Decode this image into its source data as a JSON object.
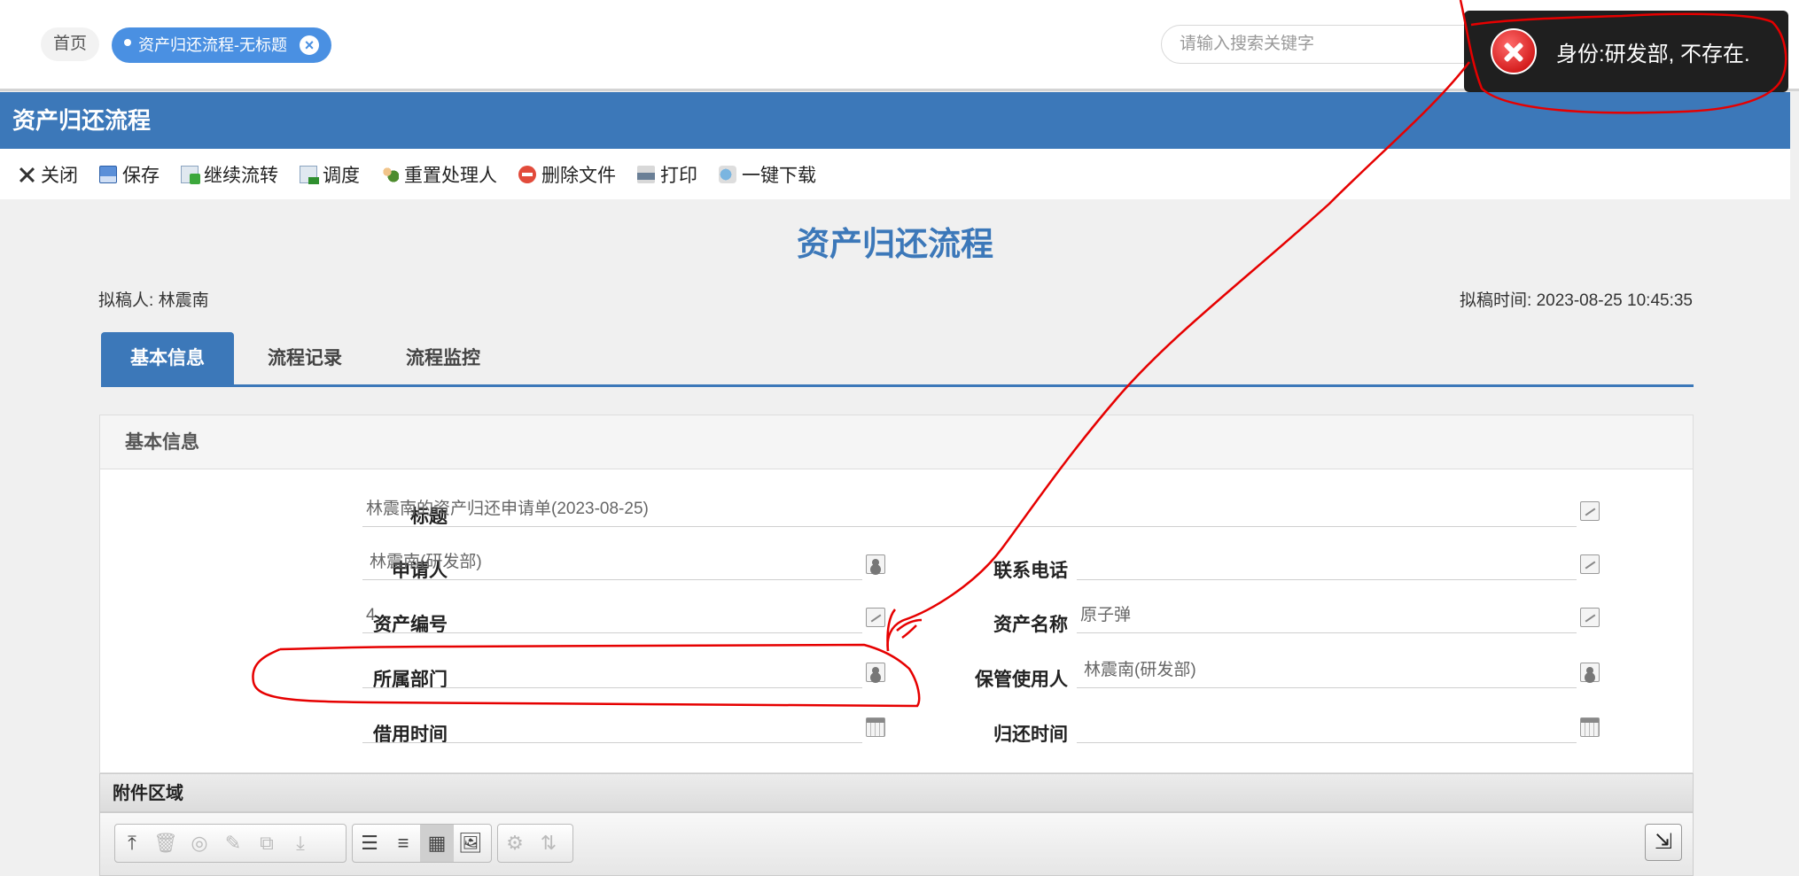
{
  "tabs_bar": {
    "home_label": "首页",
    "active_tab_label": "资产归还流程-无标题",
    "search_placeholder": "请输入搜索关键字"
  },
  "toast": {
    "message": "身份:研发部, 不存在."
  },
  "header": {
    "title": "资产归还流程"
  },
  "toolbar": {
    "items": [
      {
        "label": "关闭",
        "icon": "close-icon"
      },
      {
        "label": "保存",
        "icon": "save-icon"
      },
      {
        "label": "继续流转",
        "icon": "forward-icon"
      },
      {
        "label": "调度",
        "icon": "dispatch-icon"
      },
      {
        "label": "重置处理人",
        "icon": "reset-users-icon"
      },
      {
        "label": "删除文件",
        "icon": "delete-icon"
      },
      {
        "label": "打印",
        "icon": "print-icon"
      },
      {
        "label": "一键下载",
        "icon": "download-icon"
      }
    ]
  },
  "document": {
    "title": "资产归还流程",
    "drafter_label": "拟稿人:",
    "drafter": "林震南",
    "draft_time_label": "拟稿时间:",
    "draft_time": "2023-08-25 10:45:35"
  },
  "doc_tabs": [
    "基本信息",
    "流程记录",
    "流程监控"
  ],
  "panel": {
    "title": "基本信息",
    "fields": {
      "title": {
        "label": "标题",
        "value": "林震南的资产归还申请单(2023-08-25)"
      },
      "applicant": {
        "label": "申请人",
        "value": "林震南(研发部)"
      },
      "phone": {
        "label": "联系电话",
        "value": ""
      },
      "asset_no": {
        "label": "资产编号",
        "value": "4"
      },
      "asset_name": {
        "label": "资产名称",
        "value": "原子弹"
      },
      "department": {
        "label": "所属部门",
        "value": ""
      },
      "custodian": {
        "label": "保管使用人",
        "value": "林震南(研发部)"
      },
      "borrow_time": {
        "label": "借用时间",
        "value": ""
      },
      "return_time": {
        "label": "归还时间",
        "value": ""
      }
    }
  },
  "attachments": {
    "title": "附件区域"
  },
  "colors": {
    "primary": "#3c78b9",
    "tab_active": "#4a90e2",
    "toast_bg": "#1f1f1f",
    "annotation_red": "#e60000"
  }
}
